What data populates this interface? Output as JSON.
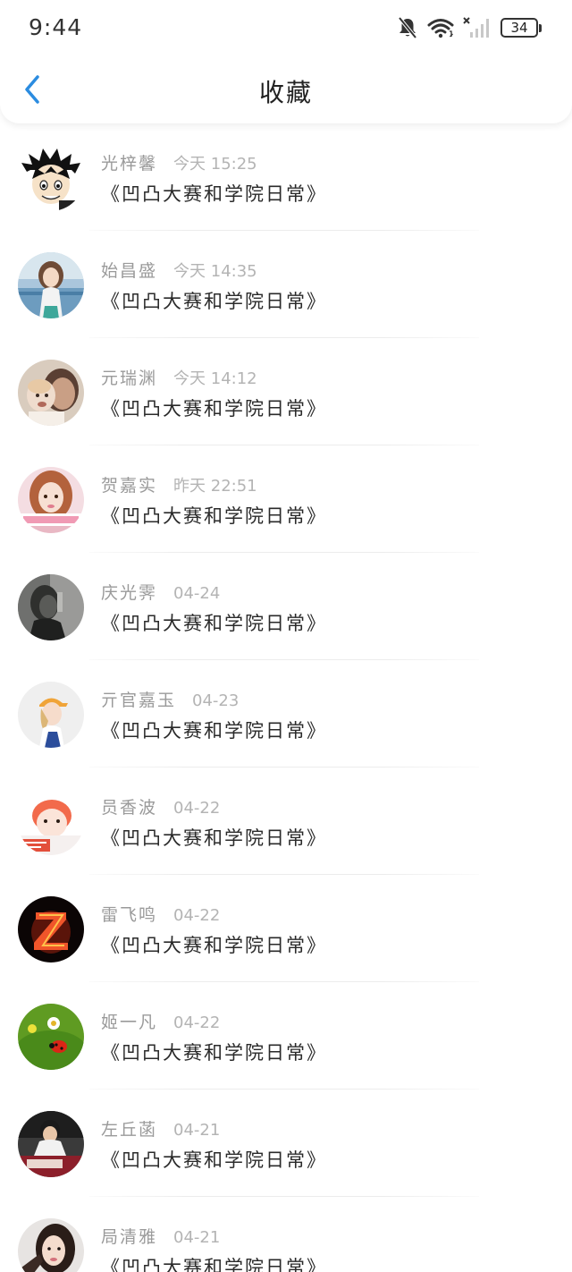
{
  "status_bar": {
    "time": "9:44",
    "battery": "34",
    "icons": [
      "bell-muted-icon",
      "wifi-icon",
      "cellular-no-signal-icon",
      "battery-icon"
    ]
  },
  "nav": {
    "back_icon": "chevron-left-icon",
    "title": "收藏"
  },
  "colors": {
    "accent": "#2b8ce0",
    "name_text": "#9a9a9a",
    "time_text": "#b4b4b4",
    "title_text": "#2a2a2a"
  },
  "favorites": [
    {
      "name": "光梓馨",
      "time": "今天 15:25",
      "title": "《凹凸大赛和学院日常》",
      "avatar": "cartoon-boy-avatar"
    },
    {
      "name": "始昌盛",
      "time": "今天 14:35",
      "title": "《凹凸大赛和学院日常》",
      "avatar": "girl-outdoor-avatar"
    },
    {
      "name": "元瑞渊",
      "time": "今天 14:12",
      "title": "《凹凸大赛和学院日常》",
      "avatar": "father-child-avatar"
    },
    {
      "name": "贺嘉实",
      "time": "昨天 22:51",
      "title": "《凹凸大赛和学院日常》",
      "avatar": "girl-sign-avatar"
    },
    {
      "name": "庆光霁",
      "time": "04-24",
      "title": "《凹凸大赛和学院日常》",
      "avatar": "dark-portrait-avatar"
    },
    {
      "name": "亓官嘉玉",
      "time": "04-23",
      "title": "《凹凸大赛和学院日常》",
      "avatar": "girl-cap-avatar"
    },
    {
      "name": "员香波",
      "time": "04-22",
      "title": "《凹凸大赛和学院日常》",
      "avatar": "baby-avatar"
    },
    {
      "name": "雷飞鸣",
      "time": "04-22",
      "title": "《凹凸大赛和学院日常》",
      "avatar": "fire-z-avatar"
    },
    {
      "name": "姬一凡",
      "time": "04-22",
      "title": "《凹凸大赛和学院日常》",
      "avatar": "ladybug-avatar"
    },
    {
      "name": "左丘菡",
      "time": "04-21",
      "title": "《凹凸大赛和学院日常》",
      "avatar": "boy-table-avatar"
    },
    {
      "name": "局清雅",
      "time": "04-21",
      "title": "《凹凸大赛和学院日常》",
      "avatar": "girl-portrait-avatar"
    }
  ]
}
